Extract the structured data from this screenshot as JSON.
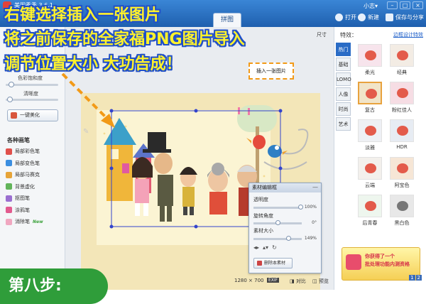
{
  "app": {
    "title": "美图秀秀 3.6.1",
    "user": "小志▾"
  },
  "toolbar": {
    "tab_label": "拼图",
    "open_label": "打开",
    "new_label": "新建",
    "save_label": "保存与分享"
  },
  "left_panel": {
    "saturation_label": "色彩饱和度",
    "sharpness_label": "清晰度",
    "beautify_button": "一键美化",
    "brush_heading": "各种画笔",
    "brushes": [
      {
        "label": "局部彩色笔",
        "color": "#e0504b"
      },
      {
        "label": "局部变色笔",
        "color": "#3b8ee0"
      },
      {
        "label": "局部马赛克",
        "color": "#e7a438"
      },
      {
        "label": "背景虚化",
        "color": "#62b45a"
      },
      {
        "label": "抠图笔",
        "color": "#9b6fd0"
      },
      {
        "label": "涂鸦笔",
        "color": "#e25a8e"
      },
      {
        "label": "消除笔",
        "color": "#f0a7c0",
        "badge": "New"
      }
    ]
  },
  "canvas": {
    "callout_label": "插入一张图片",
    "size_label": "1280 × 700",
    "exif_label": "EXIF",
    "compare_label": "对比",
    "preview_label": "预览",
    "size_hint": "尺寸"
  },
  "material_dialog": {
    "title": "素材编辑框",
    "opacity_label": "透明度",
    "opacity_value": "100%",
    "rotate_label": "旋转角度",
    "rotate_value": "0°",
    "size_label": "素材大小",
    "size_value": "149%",
    "delete_button": "删除本素材"
  },
  "right_panel": {
    "title": "特效：",
    "link": "边框设计特效",
    "tabs": [
      "热门",
      "基础",
      "LOMO",
      "人像",
      "时尚",
      "艺术"
    ],
    "active_tab": 0,
    "effects": [
      "柔光",
      "经典",
      "复古",
      "粉红佳人",
      "淡雅",
      "HDR",
      "云端",
      "阿宝色",
      "后青春",
      "黑白色"
    ],
    "selected_effect": 2,
    "promo_line1": "你获得了一个",
    "promo_line2": "批处理功能内测资格",
    "pages": [
      "1",
      "2"
    ]
  },
  "overlay": {
    "line1": "右键选择插入一张图片",
    "line2": "将之前保存的全家福PNG图片导入",
    "line3": "调节位置大小  大功告成！",
    "step_label": "第八步:"
  },
  "colors": {
    "titlebar": "#2d72c4",
    "overlay_text": "#fff22b",
    "overlay_outline": "#2150c8",
    "callout_border": "#f29a18",
    "step_bg": "#2f9d3a",
    "selection": "#3344cc"
  }
}
